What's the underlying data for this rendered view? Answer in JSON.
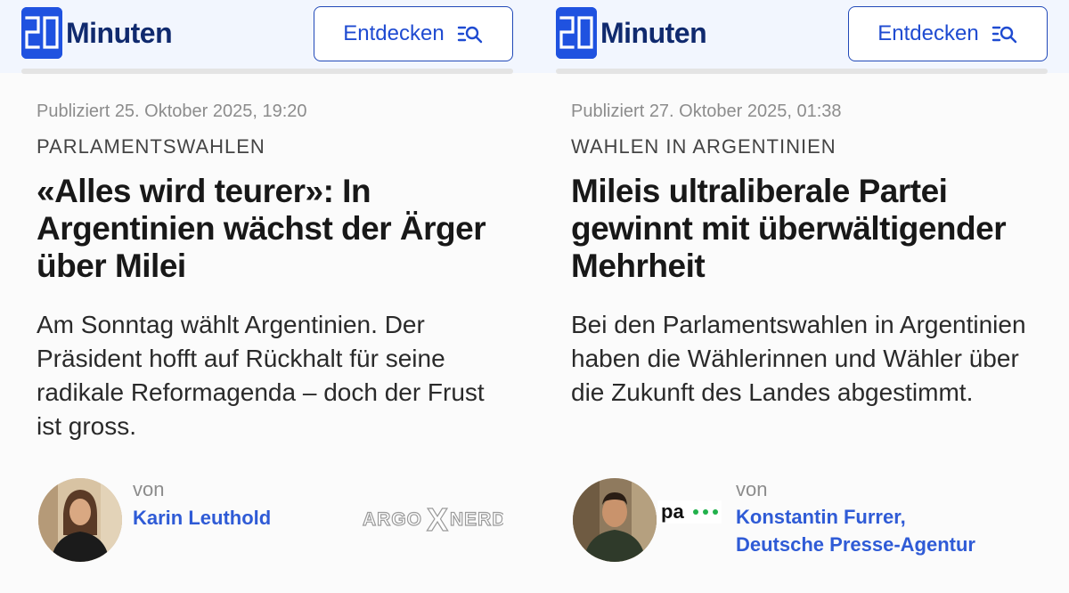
{
  "brand": {
    "name": "Minuten",
    "logo_number": "20",
    "color": "#1f52e0"
  },
  "header": {
    "discover_label": "Entdecken"
  },
  "articles": [
    {
      "published": "Publiziert 25. Oktober 2025, 19:20",
      "kicker": "PARLAMENTSWAHLEN",
      "headline": "«Alles wird teurer»: In Argentinien wächst der Ärger über Milei",
      "lead": "Am Sonntag wählt Argentinien. Der Präsident hofft auf Rückhalt für seine radikale Reformagenda – doch der Frust ist gross.",
      "byline_prefix": "von",
      "authors": [
        "Karin Leuthold"
      ],
      "partner_logo": "ARGO NERD"
    },
    {
      "published": "Publiziert 27. Oktober 2025, 01:38",
      "kicker": "WAHLEN IN ARGENTINIEN",
      "headline": "Mileis ultraliberale Partei gewinnt mit überwältigender Mehrheit",
      "lead": "Bei den Parlamentswahlen in Argentinien haben die Wählerinnen und Wähler über die Zukunft des Landes abgestimmt.",
      "byline_prefix": "von",
      "authors": [
        "Konstantin Furrer,",
        "Deutsche Presse-Agentur"
      ],
      "partner_logo": "pa"
    }
  ],
  "colors": {
    "accent": "#1f4bd1",
    "author_link": "#2f5bd6",
    "meta_gray": "#8c8c8c",
    "dpa_green": "#22b14c"
  }
}
